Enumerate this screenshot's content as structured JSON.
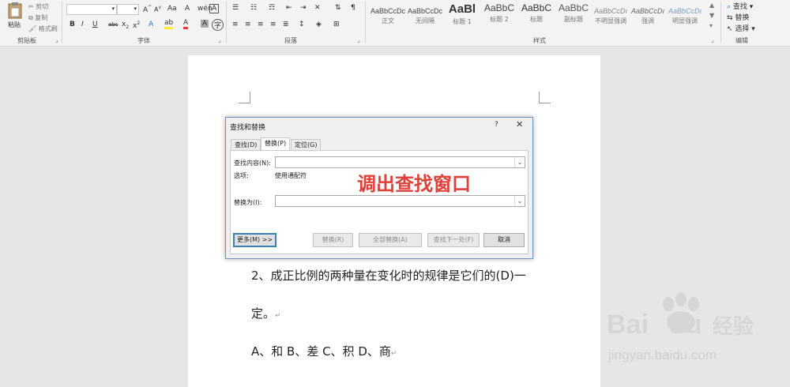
{
  "ribbon": {
    "clipboard": {
      "paste": "粘贴",
      "cut": "剪切",
      "copy": "复制",
      "format_painter": "格式刷",
      "group": "剪贴板"
    },
    "font": {
      "name_value": "",
      "size_value": "",
      "group": "字体"
    },
    "paragraph": {
      "group": "段落"
    },
    "styles": {
      "group": "样式",
      "items": [
        {
          "sample": "AaBbCcDc",
          "name": "正文"
        },
        {
          "sample": "AaBbCcDc",
          "name": "无间隔"
        },
        {
          "sample": "AaBl",
          "name": "标题 1"
        },
        {
          "sample": "AaBbC",
          "name": "标题 2"
        },
        {
          "sample": "AaBbC",
          "name": "标题"
        },
        {
          "sample": "AaBbC",
          "name": "副标题"
        },
        {
          "sample": "AaBbCcDı",
          "name": "不明显强调"
        },
        {
          "sample": "AaBbCcDı",
          "name": "强调"
        },
        {
          "sample": "AaBbCcDı",
          "name": "明显强调"
        }
      ]
    },
    "editing": {
      "find": "查找",
      "replace": "替换",
      "select": "选择",
      "group": "编辑"
    }
  },
  "dialog": {
    "title": "查找和替换",
    "help": "?",
    "close": "✕",
    "tabs": [
      {
        "label": "查找(D)",
        "active": false
      },
      {
        "label": "替换(P)",
        "active": true
      },
      {
        "label": "定位(G)",
        "active": false
      }
    ],
    "find_label": "查找内容(N):",
    "find_value": "",
    "options_label": "选项:",
    "options_value": "使用通配符",
    "replace_label": "替换为(I):",
    "replace_value": "",
    "buttons": {
      "more": "更多(M) >>",
      "replace": "替换(R)",
      "replace_all": "全部替换(A)",
      "find_next": "查找下一处(F)",
      "cancel": "取消"
    }
  },
  "annotation": "调出查找窗口",
  "document": {
    "line1": "2、成正比例的两种量在变化时的规律是它们的(D)一",
    "line2": "定。",
    "line3": "A、和 B、差 C、积 D、商"
  },
  "watermark": {
    "brand": "Bai",
    "brand2": "du",
    "cn": "经验",
    "url": "jingyan.baidu.com"
  }
}
